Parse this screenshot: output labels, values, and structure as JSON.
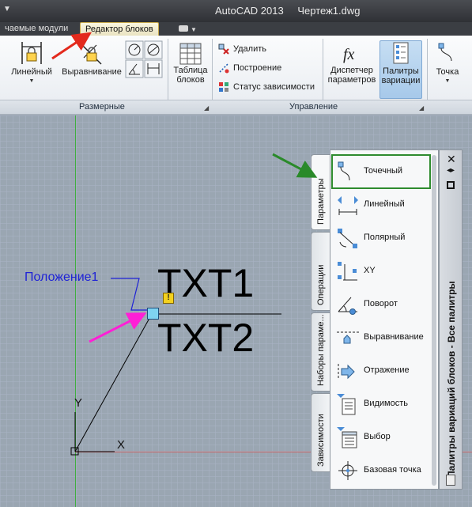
{
  "app": {
    "title": "AutoCAD 2013",
    "document": "Чертеж1.dwg",
    "menu_glyph": "▼"
  },
  "tabs": [
    {
      "label": "чаемые модули"
    },
    {
      "label": "Редактор блоков"
    }
  ],
  "ribbon": {
    "buttons": {
      "linear": "Линейный",
      "align": "Выравнивание",
      "table_line1": "Таблица",
      "table_line2": "блоков",
      "delete": "Удалить",
      "build": "Построение",
      "status": "Статус зависимости",
      "params_line1": "Диспетчер",
      "params_line2": "параметров",
      "palettes_line1": "Палитры",
      "palettes_line2": "вариации",
      "point": "Точка"
    },
    "groups": {
      "dimensional": "Размерные",
      "manage": "Управление"
    }
  },
  "canvas": {
    "txt1": "TXT1",
    "txt2": "TXT2",
    "param_label": "Положение1",
    "axis_y": "Y",
    "axis_x": "X",
    "warning_glyph": "!"
  },
  "palette": {
    "title": "Палитры вариаций блоков - Все палитры",
    "tabs": [
      "Параметры",
      "Операции",
      "Наборы параме...",
      "Зависимости"
    ],
    "items": [
      {
        "label": "Точечный",
        "icon": "point-param-icon"
      },
      {
        "label": "Линейный",
        "icon": "linear-param-icon"
      },
      {
        "label": "Полярный",
        "icon": "polar-param-icon"
      },
      {
        "label": "XY",
        "icon": "xy-param-icon"
      },
      {
        "label": "Поворот",
        "icon": "rotate-param-icon"
      },
      {
        "label": "Выравнивание",
        "icon": "align-param-icon"
      },
      {
        "label": "Отражение",
        "icon": "flip-param-icon"
      },
      {
        "label": "Видимость",
        "icon": "visibility-param-icon"
      },
      {
        "label": "Выбор",
        "icon": "lookup-param-icon"
      },
      {
        "label": "Базовая точка",
        "icon": "basepoint-param-icon"
      }
    ],
    "close_glyph": "✕"
  }
}
